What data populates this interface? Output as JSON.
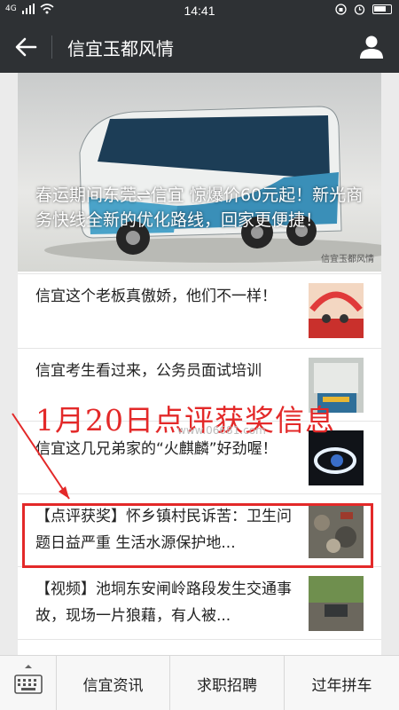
{
  "status_bar": {
    "signal": "4G",
    "time": "14:41"
  },
  "nav": {
    "title": "信宜玉都风情"
  },
  "hero": {
    "caption": "春运期间东莞⇌信宜 惊爆价60元起！新光商务快线全新的优化路线，回家更便捷！",
    "watermark": "信宜玉都风情"
  },
  "articles": [
    {
      "title": "信宜这个老板真傲娇，他们不一样！"
    },
    {
      "title": "信宜考生看过来，公务员面试培训"
    },
    {
      "title": "信宜这几兄弟家的“火麒麟”好劲喔！"
    },
    {
      "title": "【点评获奖】怀乡镇村民诉苦：卫生问题日益严重 生活水源保护地..."
    },
    {
      "title": "【视频】池垌东安闸岭路段发生交通事故，现场一片狼藉，有人被..."
    }
  ],
  "overlay": {
    "banner": "1月20日点评获奖信息",
    "site_watermark": "www.06681.com"
  },
  "bottom_menu": [
    {
      "label": "信宜资讯"
    },
    {
      "label": "求职招聘"
    },
    {
      "label": "过年拼车"
    }
  ],
  "colors": {
    "bar": "#2e3134",
    "highlight": "#e32929"
  }
}
